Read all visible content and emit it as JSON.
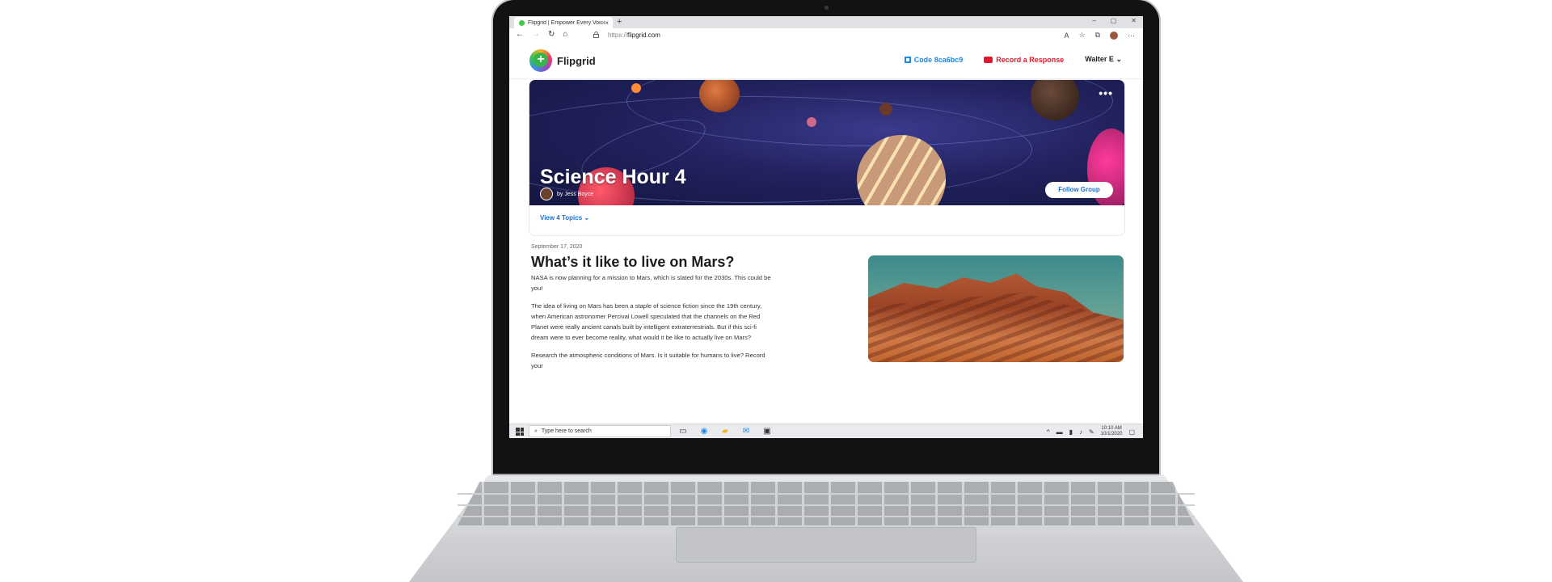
{
  "browser": {
    "tab_title": "Flipgrid | Empower Every Voice",
    "tab_close": "×",
    "new_tab": "+",
    "win_min": "–",
    "win_max": "▢",
    "win_close": "✕",
    "url_protocol": "https://",
    "url_host": "flipgrid.com",
    "back": "←",
    "forward": "→",
    "refresh": "↻",
    "home": "⌂",
    "lock": "🔒",
    "more": "···"
  },
  "header": {
    "logo_text": "Flipgrid",
    "code_label": "Code 8ca6bc9",
    "record_label": "Record a Response",
    "user_label": "Walter E",
    "user_chevron": "⌄"
  },
  "banner": {
    "title": "Science Hour 4",
    "byline": "by Jess Boyce",
    "more": "•••",
    "follow_label": "Follow Group",
    "topics_label": "View 4 Topics ⌄"
  },
  "post": {
    "date": "September 17, 2020",
    "title": "What’s it like to live on Mars?",
    "paragraphs": [
      "NASA is now planning for a mission to Mars, which is slated for the 2030s. This could be you!",
      "The idea of living on Mars has been a staple of science fiction since the 19th century, when American astronomer Percival Lowell speculated that the channels on the Red Planet were really ancient canals built by intelligent extraterrestrials. But if this sci-fi dream were to ever become reality, what would it be like to actually live on Mars?",
      "Research the atmospheric conditions of Mars. Is it suitable for humans to live? Record your"
    ]
  },
  "taskbar": {
    "search_icon": "⌕",
    "search_placeholder": "Type here to search",
    "time": "10:10 AM",
    "date": "10/1/2020"
  },
  "colors": {
    "accent_blue": "#1e88e5",
    "record_red": "#e0182d",
    "banner_bg": "#22225f"
  }
}
